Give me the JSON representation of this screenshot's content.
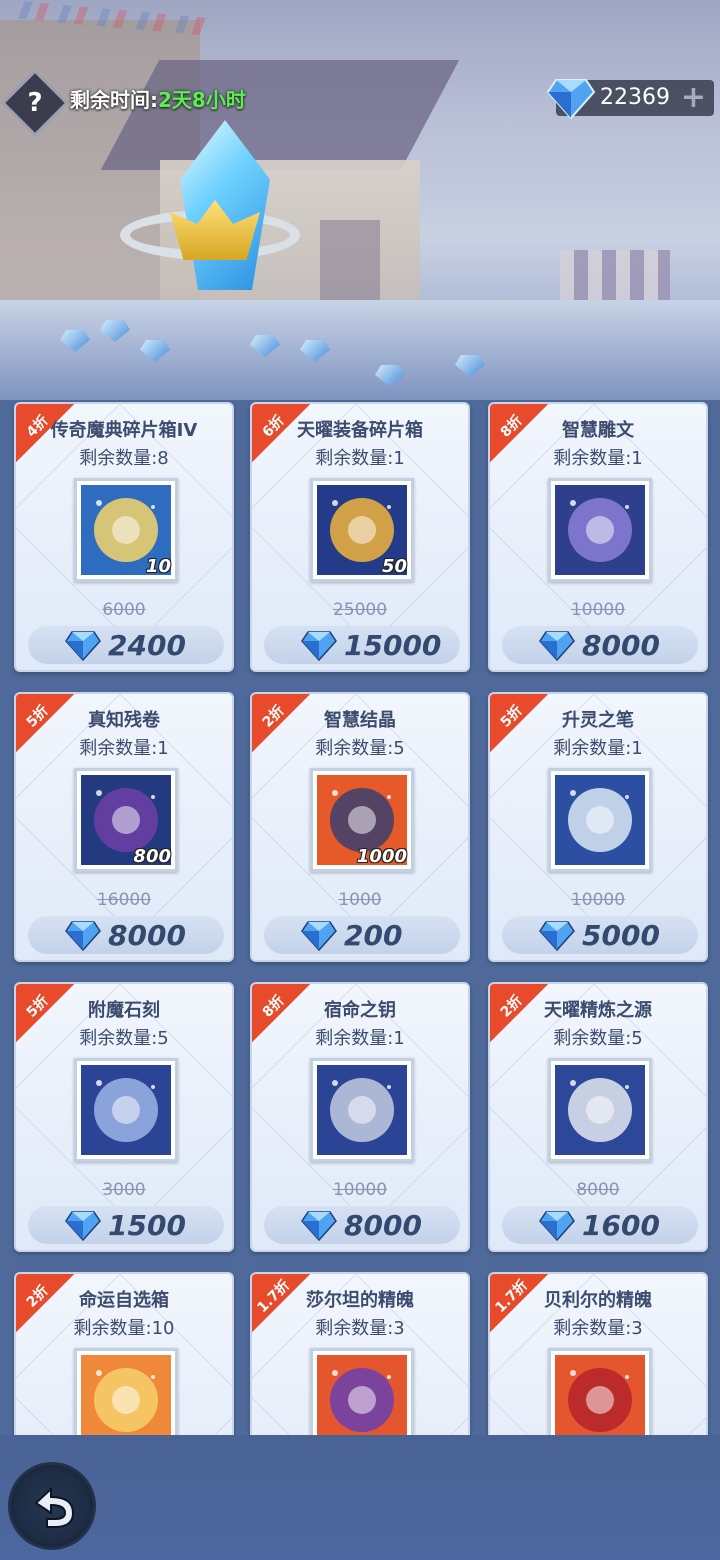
{
  "header": {
    "help_symbol": "?",
    "timer_label": "剩余时间:",
    "timer_value": "2天8小时",
    "currency_value": "22369",
    "currency_add": "+"
  },
  "items": [
    {
      "discount": "4折",
      "name": "传奇魔典碎片箱IV",
      "remain": "剩余数量:8",
      "qty": "10",
      "original": "6000",
      "price": "2400",
      "icon": "cube-chest-icon"
    },
    {
      "discount": "6折",
      "name": "天曜装备碎片箱",
      "remain": "剩余数量:1",
      "qty": "50",
      "original": "25000",
      "price": "15000",
      "icon": "golden-helmet-icon"
    },
    {
      "discount": "8折",
      "name": "智慧雕文",
      "remain": "剩余数量:1",
      "qty": "",
      "original": "10000",
      "price": "8000",
      "icon": "star-rune-icon"
    },
    {
      "discount": "5折",
      "name": "真知残卷",
      "remain": "剩余数量:1",
      "qty": "800",
      "original": "16000",
      "price": "8000",
      "icon": "scroll-icon"
    },
    {
      "discount": "2折",
      "name": "智慧结晶",
      "remain": "剩余数量:5",
      "qty": "1000",
      "original": "1000",
      "price": "200",
      "icon": "dark-crystal-icon"
    },
    {
      "discount": "5折",
      "name": "升灵之笔",
      "remain": "剩余数量:1",
      "qty": "",
      "original": "10000",
      "price": "5000",
      "icon": "quill-pen-icon"
    },
    {
      "discount": "5折",
      "name": "附魔石刻",
      "remain": "剩余数量:5",
      "qty": "",
      "original": "3000",
      "price": "1500",
      "icon": "hex-stone-icon"
    },
    {
      "discount": "8折",
      "name": "宿命之钥",
      "remain": "剩余数量:1",
      "qty": "",
      "original": "10000",
      "price": "8000",
      "icon": "key-icon"
    },
    {
      "discount": "2折",
      "name": "天曜精炼之源",
      "remain": "剩余数量:5",
      "qty": "",
      "original": "8000",
      "price": "1600",
      "icon": "silver-cylinder-icon"
    },
    {
      "discount": "2折",
      "name": "命运自选箱",
      "remain": "剩余数量:10",
      "qty": "",
      "original": "",
      "price": "",
      "icon": "gold-chest-icon"
    },
    {
      "discount": "1.7折",
      "name": "莎尔坦的精魄",
      "remain": "剩余数量:3",
      "qty": "",
      "original": "",
      "price": "",
      "icon": "purple-orb-icon"
    },
    {
      "discount": "1.7折",
      "name": "贝利尔的精魄",
      "remain": "剩余数量:3",
      "qty": "",
      "original": "",
      "price": "",
      "icon": "red-orb-icon"
    }
  ],
  "colors": {
    "discount_ribbon": "#e84a2c",
    "timer_value": "#59ef4e",
    "price_text": "#34496f"
  }
}
